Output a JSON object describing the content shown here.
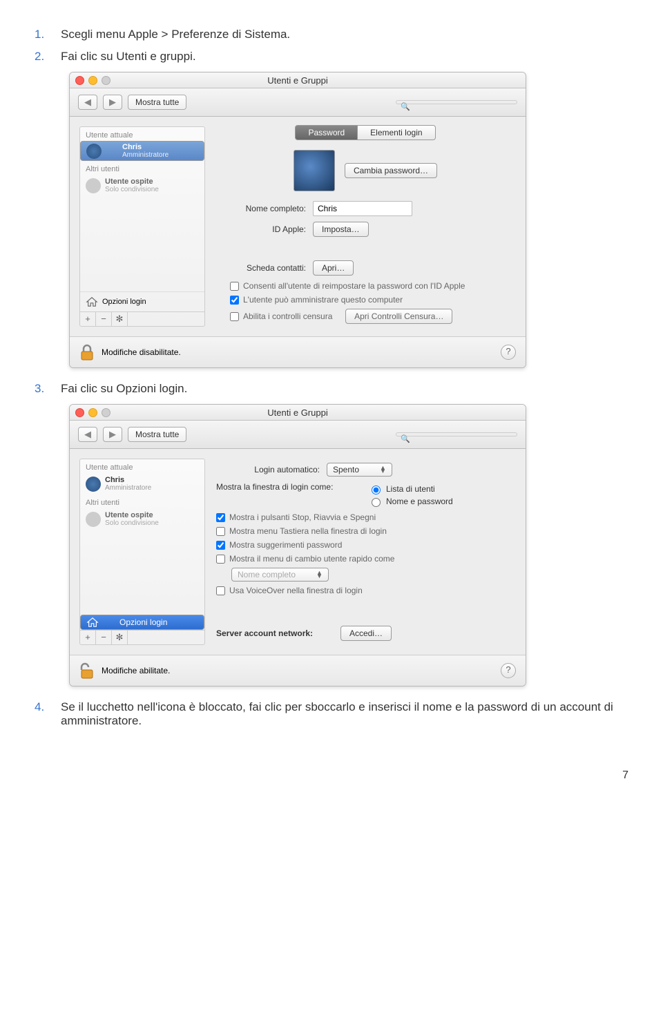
{
  "steps": {
    "s1_num": "1.",
    "s1_text": "Scegli menu Apple > Preferenze di Sistema.",
    "s2_num": "2.",
    "s2_text": "Fai clic su Utenti e gruppi.",
    "s3_num": "3.",
    "s3_text": "Fai clic su Opzioni login.",
    "s4_num": "4.",
    "s4_text": "Se il lucchetto nell'icona è bloccato, fai clic per sboccarlo e inserisci il nome e la password di un account di amministratore."
  },
  "win1": {
    "title": "Utenti e Gruppi",
    "show_all": "Mostra tutte",
    "sidebar": {
      "current": "Utente attuale",
      "user_name": "Chris",
      "user_role": "Amministratore",
      "other": "Altri utenti",
      "guest_name": "Utente ospite",
      "guest_role": "Solo condivisione",
      "login_opts": "Opzioni login"
    },
    "tabs": {
      "password": "Password",
      "login_items": "Elementi login"
    },
    "change_pw": "Cambia password…",
    "fullname_lbl": "Nome completo:",
    "fullname_val": "Chris",
    "appleid_lbl": "ID Apple:",
    "appleid_btn": "Imposta…",
    "contact_lbl": "Scheda contatti:",
    "contact_btn": "Apri…",
    "chk_reset": "Consenti all'utente di reimpostare la password con l'ID Apple",
    "chk_admin": "L'utente può amministrare questo computer",
    "chk_censor": "Abilita i controlli censura",
    "censor_btn": "Apri Controlli Censura…",
    "footer": "Modifiche disabilitate."
  },
  "win2": {
    "title": "Utenti e Gruppi",
    "show_all": "Mostra tutte",
    "sidebar": {
      "current": "Utente attuale",
      "user_name": "Chris",
      "user_role": "Amministratore",
      "other": "Altri utenti",
      "guest_name": "Utente ospite",
      "guest_role": "Solo condivisione",
      "login_opts": "Opzioni login"
    },
    "auto_lbl": "Login automatico:",
    "auto_val": "Spento",
    "showwin_lbl": "Mostra la finestra di login come:",
    "radio1": "Lista di utenti",
    "radio2": "Nome e password",
    "chk1": "Mostra i pulsanti Stop, Riavvia e Spegni",
    "chk2": "Mostra menu Tastiera nella finestra di login",
    "chk3": "Mostra suggerimenti password",
    "chk4": "Mostra il menu di cambio utente rapido come",
    "fast_val": "Nome completo",
    "chk5": "Usa VoiceOver nella finestra di login",
    "server_lbl": "Server account network:",
    "server_btn": "Accedi…",
    "footer": "Modifiche abilitate."
  },
  "page": "7"
}
